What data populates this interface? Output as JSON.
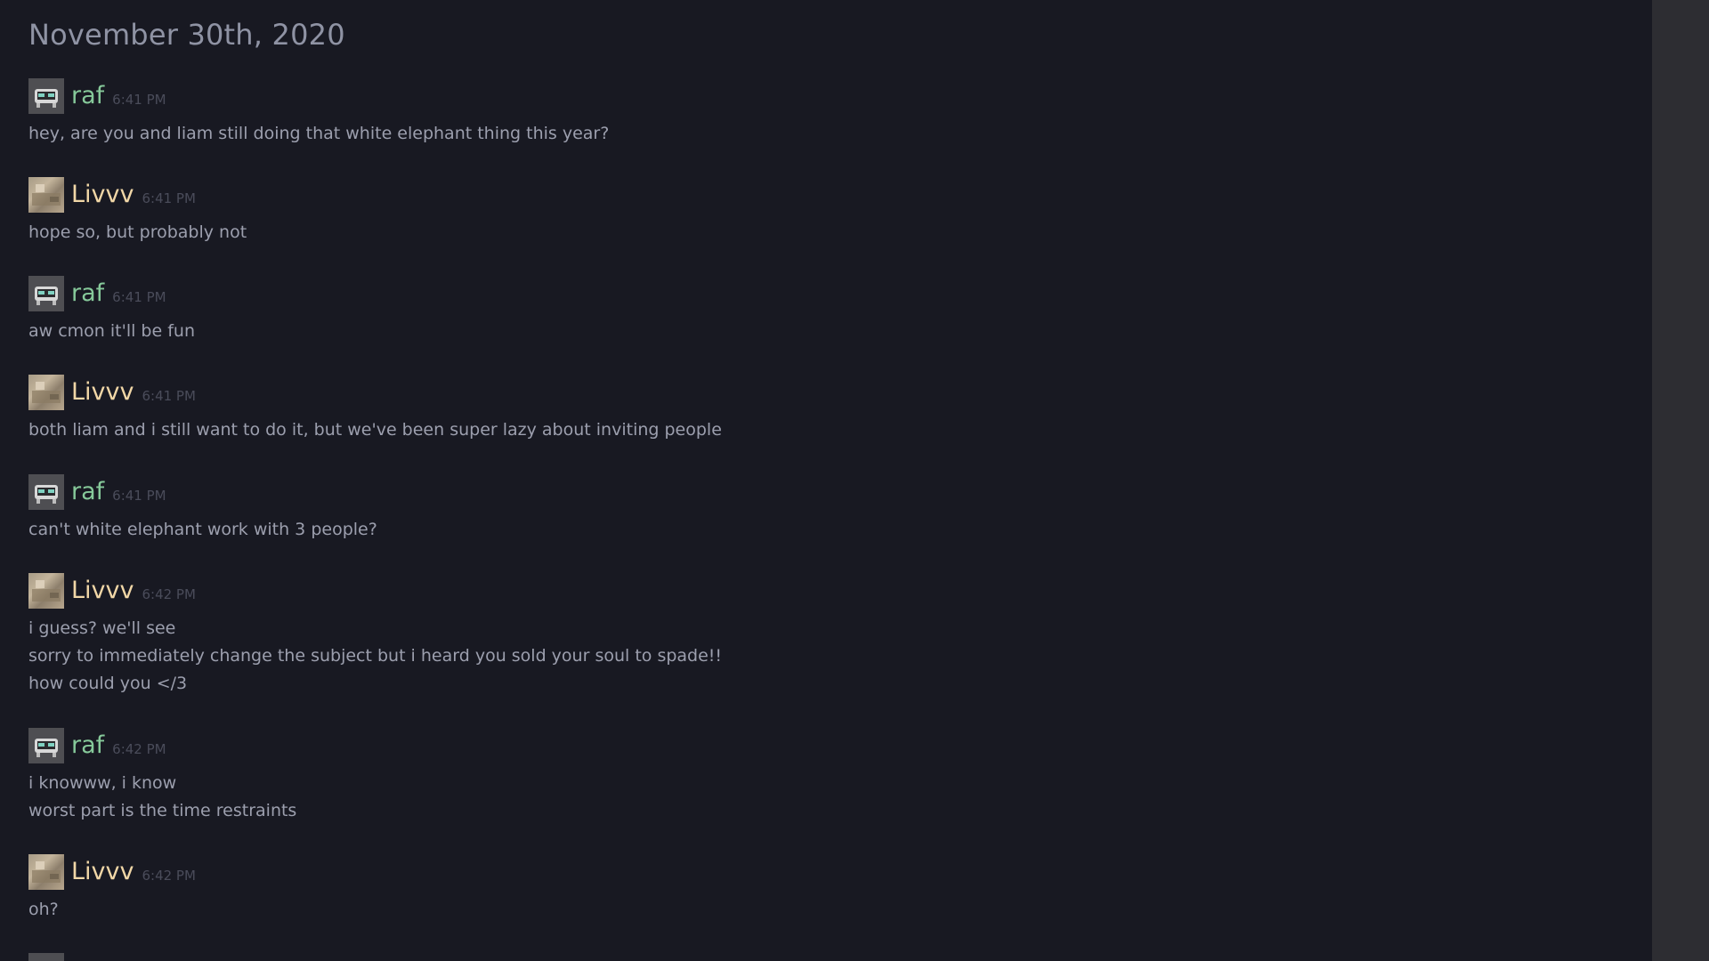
{
  "date_header": "November 30th, 2020",
  "messages": [
    {
      "author": "raf",
      "time": "6:41 PM",
      "lines": [
        "hey, are you and liam still doing that white elephant thing this year?"
      ]
    },
    {
      "author": "Livvv",
      "time": "6:41 PM",
      "lines": [
        "hope so, but probably not"
      ]
    },
    {
      "author": "raf",
      "time": "6:41 PM",
      "lines": [
        "aw cmon it'll be fun"
      ]
    },
    {
      "author": "Livvv",
      "time": "6:41 PM",
      "lines": [
        "both liam and i still want to do it, but we've been super lazy about inviting people"
      ]
    },
    {
      "author": "raf",
      "time": "6:41 PM",
      "lines": [
        "can't white elephant work with 3 people?"
      ]
    },
    {
      "author": "Livvv",
      "time": "6:42 PM",
      "lines": [
        "i guess? we'll see",
        "sorry to immediately change the subject but i heard you sold your soul to spade!!",
        "how could you </3"
      ]
    },
    {
      "author": "raf",
      "time": "6:42 PM",
      "lines": [
        "i knowww, i know",
        "worst part is the time restraints"
      ]
    },
    {
      "author": "Livvv",
      "time": "6:42 PM",
      "lines": [
        "oh?"
      ]
    }
  ],
  "colors": {
    "background": "#181922",
    "scrollbar_track": "#2d2d32",
    "raf_name": "#86c99a",
    "livvv_name": "#f1d7a7",
    "message_text": "#9c9fae",
    "timestamp": "#4a4c5a"
  },
  "icons": {
    "raf_avatar": "robot-avatar-icon",
    "livvv_avatar": "photo-avatar-icon"
  }
}
